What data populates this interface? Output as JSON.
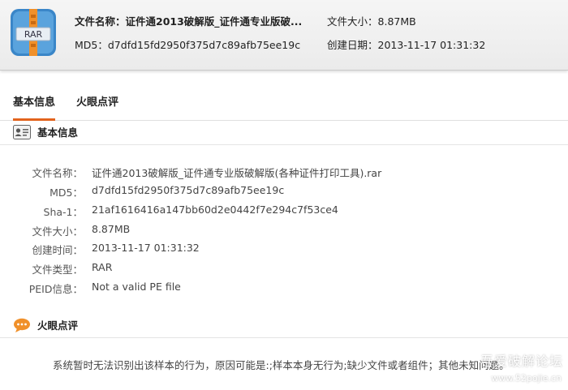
{
  "header": {
    "icon_text": "RAR",
    "file_name_label": "文件名称：",
    "file_name_value": "证件通2013破解版_证件通专业版破...",
    "md5_label": "MD5：",
    "md5_value": "d7dfd15fd2950f375d7c89afb75ee19c",
    "size_label": "文件大小：",
    "size_value": "8.87MB",
    "date_label": "创建日期：",
    "date_value": "2013-11-17 01:31:32"
  },
  "tabs": [
    {
      "label": "基本信息",
      "active": true
    },
    {
      "label": "火眼点评",
      "active": false
    }
  ],
  "basic_section": {
    "title": "基本信息",
    "rows": [
      {
        "key": "文件名称：",
        "value": "证件通2013破解版_证件通专业版破解版(各种证件打印工具).rar"
      },
      {
        "key": "MD5：",
        "value": "d7dfd15fd2950f375d7c89afb75ee19c"
      },
      {
        "key": "Sha-1：",
        "value": "21af1616416a147bb60d2e0442f7e294c7f53ce4"
      },
      {
        "key": "文件大小：",
        "value": "8.87MB"
      },
      {
        "key": "创建时间：",
        "value": "2013-11-17 01:31:32"
      },
      {
        "key": "文件类型：",
        "value": "RAR"
      },
      {
        "key": "PEID信息：",
        "value": "Not a valid PE file"
      }
    ]
  },
  "review_section": {
    "title": "火眼点评",
    "comment": "系统暂时无法识别出该样本的行为，原因可能是:;样本本身无行为;缺少文件或者组件；其他未知问题。"
  },
  "watermark": {
    "text": "吾爱破解论坛",
    "url": "www.52pojie.cn"
  },
  "colors": {
    "tab_accent": "#e2631d",
    "icon_orange": "#f0902a",
    "icon_blue": "#3a86c8"
  }
}
